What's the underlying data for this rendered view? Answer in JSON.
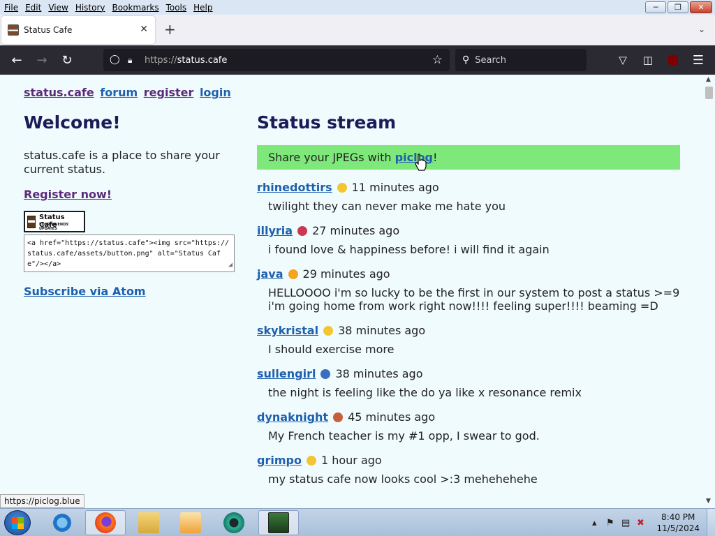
{
  "menubar": {
    "items": [
      "File",
      "Edit",
      "View",
      "History",
      "Bookmarks",
      "Tools",
      "Help"
    ]
  },
  "tab": {
    "title": "Status Cafe"
  },
  "navbar": {
    "url_proto": "https://",
    "url_host": "status.cafe",
    "search_placeholder": "Search"
  },
  "page": {
    "topnav": [
      "status.cafe",
      "forum",
      "register",
      "login"
    ],
    "welcome_title": "Welcome!",
    "intro": "status.cafe is a place to share your current status.",
    "register_link": "Register now!",
    "badge_title": "Status Cafe",
    "badge_sub": "YOUR FRIENDS' UPDATES",
    "embed_code": "<a href=\"https://status.cafe\"><img src=\"https://status.cafe/assets/button.png\" alt=\"Status Cafe\"/></a>",
    "atom_link": "Subscribe via Atom",
    "stream_title": "Status stream",
    "banner_prefix": "Share your JPEGs with ",
    "banner_link": "piclog",
    "banner_suffix": "!",
    "entries": [
      {
        "user": "rhinedottirs",
        "emoji": "crescent-moon",
        "color": "#f3c531",
        "time": "11 minutes ago",
        "message": "twilight they can never make me hate you"
      },
      {
        "user": "illyria",
        "emoji": "red-blob",
        "color": "#c93a4f",
        "time": "27 minutes ago",
        "message": "i found love & happiness before! i will find it again"
      },
      {
        "user": "java",
        "emoji": "sun",
        "color": "#f4a41f",
        "time": "29 minutes ago",
        "message": "HELLOOOO i'm so lucky to be the first in our system to post a status >=9 i'm going home from work right now!!!! feeling super!!!! beaming =D"
      },
      {
        "user": "skykristal",
        "emoji": "face-with-monocle",
        "color": "#f3c531",
        "time": "38 minutes ago",
        "message": "I should exercise more"
      },
      {
        "user": "sullengirl",
        "emoji": "television",
        "color": "#3a6fbf",
        "time": "38 minutes ago",
        "message": "the night is feeling like the do ya like x resonance remix"
      },
      {
        "user": "dynaknight",
        "emoji": "books",
        "color": "#c95e3a",
        "time": "45 minutes ago",
        "message": "My French teacher is my #1 opp, I swear to god."
      },
      {
        "user": "grimpo",
        "emoji": "slightly-smiling-face",
        "color": "#f3c531",
        "time": "1 hour ago",
        "message": "my status cafe now looks cool >:3 mehehehehe"
      }
    ]
  },
  "statusbar": {
    "text": "https://piclog.blue"
  },
  "taskbar": {
    "time": "8:40 PM",
    "date": "11/5/2024"
  }
}
